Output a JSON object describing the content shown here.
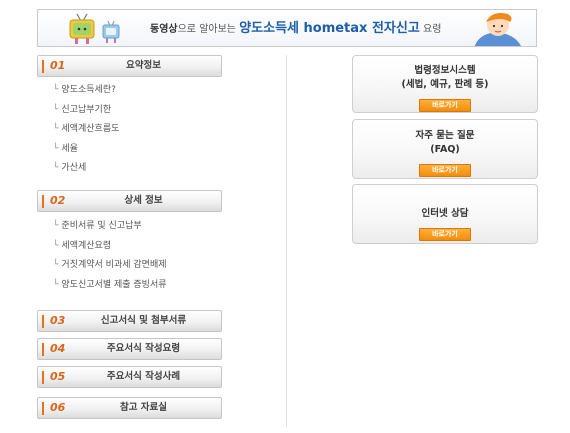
{
  "banner": {
    "text_strong": "동영상",
    "text_mid": "으로 알아보는",
    "text_brand": "양도소득세 hometax 전자신고",
    "text_tail": "요령"
  },
  "sections": [
    {
      "num": "01",
      "title": "요약정보",
      "items": [
        "양도소득세란?",
        "신고납부기한",
        "세액계산흐름도",
        "세율",
        "가산세"
      ]
    },
    {
      "num": "02",
      "title": "상세 정보",
      "items": [
        "준비서류 및 신고납부",
        "세액계산요령",
        "거짓계약서 비과세 감면배제",
        "양도신고서별 제출 증빙서류"
      ]
    },
    {
      "num": "03",
      "title": "신고서식 및 첨부서류",
      "items": []
    },
    {
      "num": "04",
      "title": "주요서식 작성요령",
      "items": []
    },
    {
      "num": "05",
      "title": "주요서식 작성사례",
      "items": []
    },
    {
      "num": "06",
      "title": "참고 자료실",
      "items": []
    }
  ],
  "cards": [
    {
      "line1": "법령정보시스템",
      "line2": "(세법, 예규, 판례 등)",
      "button": "바로가기"
    },
    {
      "line1": "자주 묻는 질문",
      "line2": "(FAQ)",
      "button": "바로가기"
    },
    {
      "line1": "인터넷 상담",
      "line2": "",
      "button": "바로가기"
    }
  ],
  "colors": {
    "accent": "#e8701a",
    "brand": "#1d5eab",
    "button": "#f28c0c"
  }
}
